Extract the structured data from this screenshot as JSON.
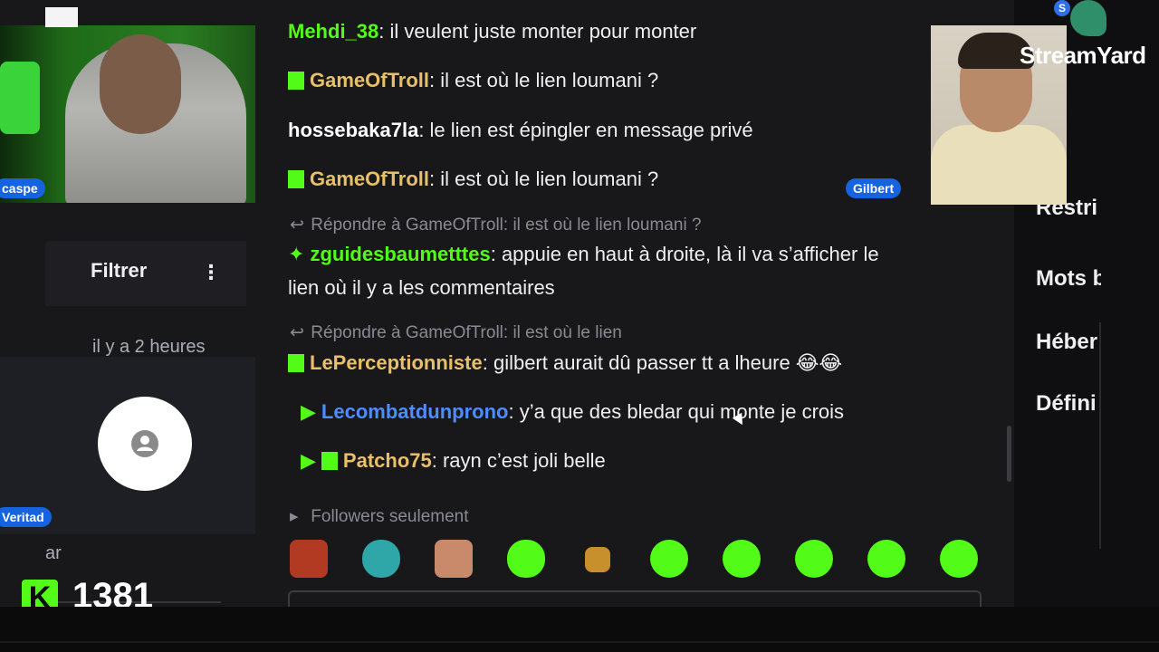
{
  "left_panel": {
    "filter_label": "Filtrer",
    "more_icon": "⋮",
    "time_ago": "il y a 2 heures",
    "partial_text": "ar"
  },
  "participants": {
    "cam1_name": "caspe",
    "cam2_name": "Gilbert",
    "avatar_name": "Veritad"
  },
  "points": {
    "logo_letter": "K",
    "value": "1381"
  },
  "streamyard": {
    "logo_text": "StreamYard",
    "badge": "S"
  },
  "chat": {
    "messages": [
      {
        "user": "Mehdi_38",
        "user_visible": "Mehdi_38",
        "user_color": "#ffffff",
        "text": "il veulent juste monter pour monter"
      },
      {
        "user": "GameOfTroll",
        "user_color": "#e8c069",
        "text": "il est où le lien loumani ?"
      },
      {
        "user": "hossebaka7la",
        "user_visible": "hossebaka7la",
        "user_color": "#ffffff",
        "text": "le lien est épingler en message privé"
      },
      {
        "user": "GameOfTroll",
        "user_color": "#e8c069",
        "text": "il est où le lien loumani ?"
      },
      {
        "reply": "Répondre à GameOfTroll: il est où le lien loumani ?",
        "user": "zguidesbaumetttes",
        "user_color": "#53fc18",
        "text": "appuie en haut à droite, là il va s’afficher le",
        "text2": "lien où il y a les commentaires"
      },
      {
        "reply": "Répondre à GameOfTroll: il est où le lien",
        "user": "LePerceptionniste",
        "user_color": "#e8c069",
        "text": "gilbert aurait dû passer tt a lheure 😂😂"
      },
      {
        "user": "Lecombatdunprono",
        "user_color": "#4c8dff",
        "text": "y’a que des bledar qui monte je crois"
      },
      {
        "user": "Patcho75",
        "user_color": "#e8c069",
        "text": "rayn c’est joli belle "
      }
    ],
    "followers_only": "Followers seulement"
  },
  "settings": {
    "items": [
      "Restri",
      "Mots b",
      "Héber",
      "Défini"
    ]
  },
  "colors": {
    "kick_green": "#53fc18",
    "panel_bg": "#18181b",
    "name_tag_blue": "#1663e0"
  },
  "emotes": [
    "laughing-face-emote",
    "hands-emote",
    "crying-face-emote",
    "angel-emote",
    "box-face-emote",
    "dizzy-emote",
    "grin-emote",
    "headphones-emote",
    "happy-emote",
    "smile-emote"
  ]
}
